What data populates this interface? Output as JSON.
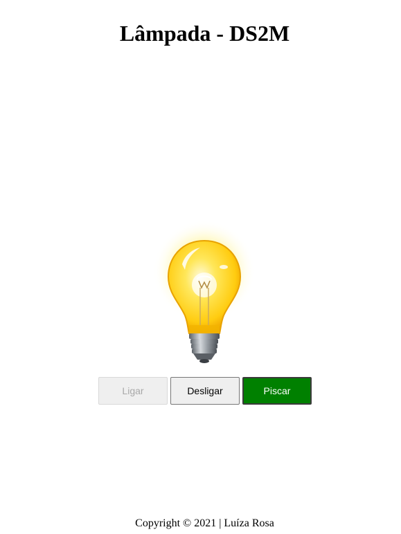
{
  "header": {
    "title": "Lâmpada - DS2M"
  },
  "lamp": {
    "state": "on",
    "icon": "lightbulb-on-icon",
    "colors": {
      "glow": "#fff6a8",
      "bulb": "#ffd21a",
      "bulb_dark": "#f0a800",
      "base": "#8a9097"
    }
  },
  "controls": {
    "on_label": "Ligar",
    "off_label": "Desligar",
    "blink_label": "Piscar",
    "on_disabled": true,
    "blink_color": "#008000"
  },
  "footer": {
    "text": "Copyright © 2021 | Luíza Rosa"
  }
}
